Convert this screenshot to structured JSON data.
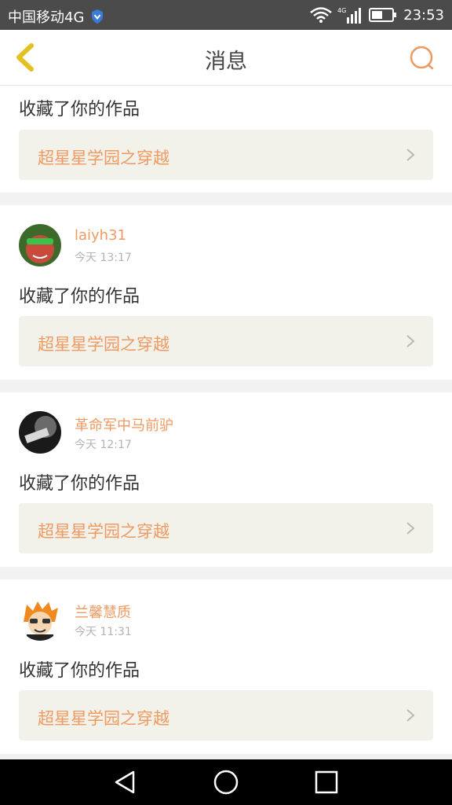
{
  "status_bar": {
    "carrier": "中国移动4G",
    "network_badge": "4G",
    "time": "23:53",
    "icons": [
      "shield-icon",
      "wifi-icon",
      "signal-icon",
      "battery-icon"
    ]
  },
  "header": {
    "title": "消息",
    "back_icon": "chevron-left-icon",
    "search_icon": "search-icon"
  },
  "colors": {
    "accent": "#ee9a62",
    "back_yellow": "#e4c020",
    "link_bg": "#f3f2ea"
  },
  "messages": [
    {
      "action": "收藏了你的作品",
      "work_title": "超星星学园之穿越"
    },
    {
      "user": "laiyh31",
      "time": "今天 13:17",
      "action": "收藏了你的作品",
      "work_title": "超星星学园之穿越"
    },
    {
      "user": "革命军中马前驴",
      "time": "今天 12:17",
      "action": "收藏了你的作品",
      "work_title": "超星星学园之穿越"
    },
    {
      "user": "兰馨慧质",
      "time": "今天 11:31",
      "action": "收藏了你的作品",
      "work_title": "超星星学园之穿越"
    }
  ],
  "nav_bar": {
    "icons": [
      "nav-back-icon",
      "nav-home-icon",
      "nav-recent-icon"
    ]
  }
}
